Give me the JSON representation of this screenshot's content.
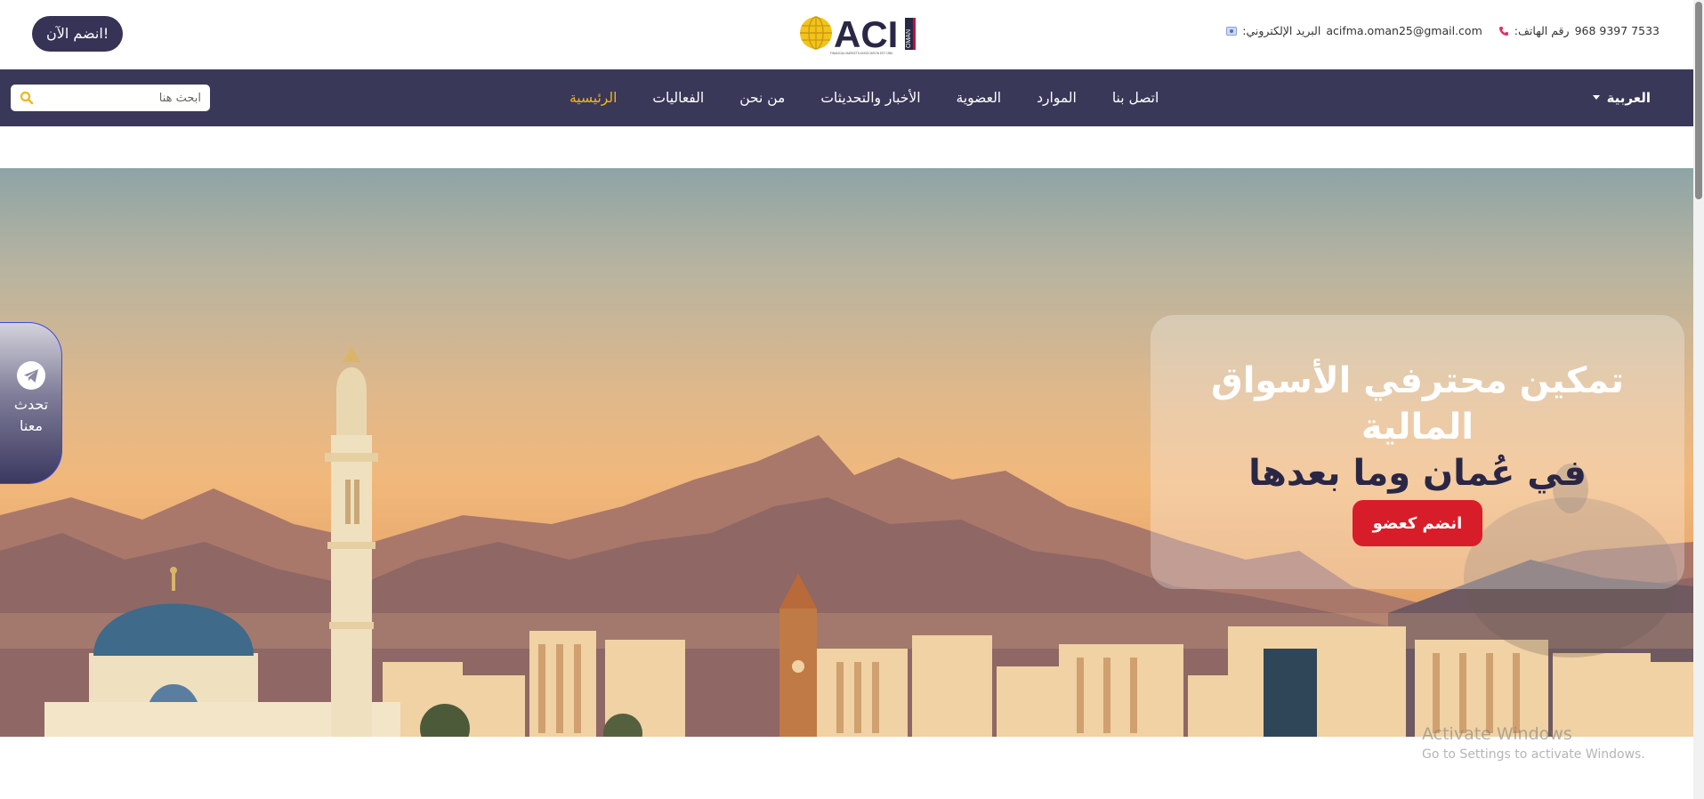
{
  "header": {
    "join_now_label": "انضم الآن!",
    "logo": {
      "text": "ACI",
      "subtext": "OMAN",
      "icon": "globe-icon"
    },
    "contact": {
      "phone_label": "رقم الهاتف:",
      "phone_value": "968 9397 7533",
      "email_label": "البريد الإلكتروني:",
      "email_value": "acifma.oman25@gmail.com"
    }
  },
  "nav": {
    "search_placeholder": "ابحث هنا",
    "links": [
      {
        "label": "الرئيسية",
        "active": true
      },
      {
        "label": "الفعاليات",
        "active": false
      },
      {
        "label": "من نحن",
        "active": false
      },
      {
        "label": "الأخبار والتحديثات",
        "active": false
      },
      {
        "label": "العضوية",
        "active": false
      },
      {
        "label": "الموارد",
        "active": false
      },
      {
        "label": "اتصل بنا",
        "active": false
      }
    ],
    "language": "العربية"
  },
  "hero": {
    "title_line1": "تمكين محترفي الأسواق المالية",
    "title_line2": "في عُمان وما بعدها",
    "cta_label": "انضم كعضو"
  },
  "chat": {
    "label_line1": "تحدث",
    "label_line2": "معنا",
    "icon": "telegram-icon"
  },
  "watermark": {
    "line1": "Activate Windows",
    "line2": "Go to Settings to activate Windows."
  },
  "colors": {
    "nav_bg": "#3a3859",
    "accent": "#f2b51d",
    "cta_red": "#d81d2a",
    "brand_dark": "#363356"
  }
}
